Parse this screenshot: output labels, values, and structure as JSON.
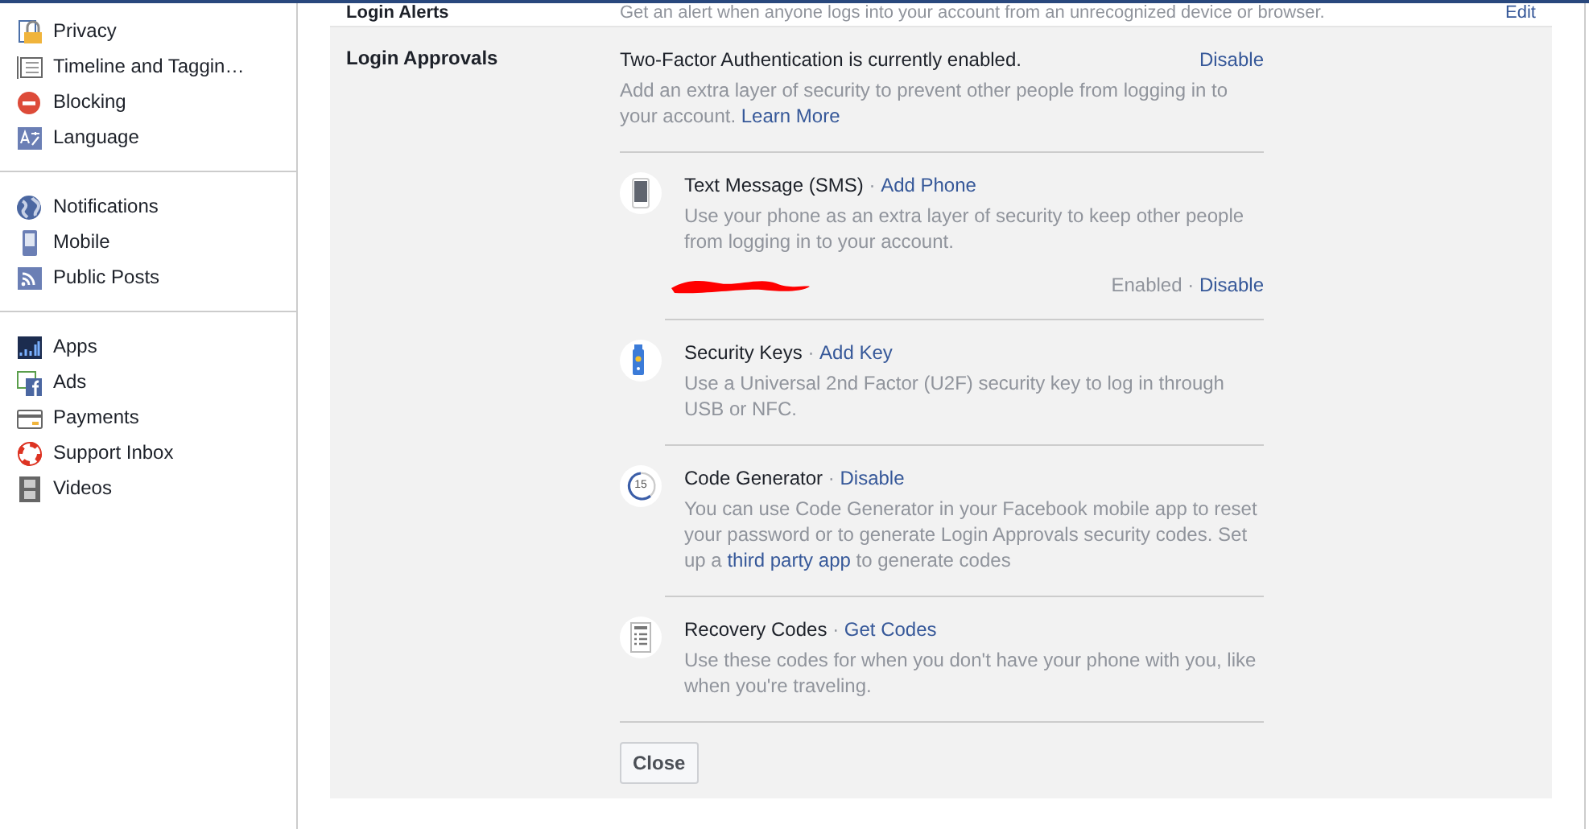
{
  "sidebar": {
    "groups": [
      {
        "items": [
          {
            "label": "Privacy"
          },
          {
            "label": "Timeline and Taggin…"
          },
          {
            "label": "Blocking"
          },
          {
            "label": "Language"
          }
        ]
      },
      {
        "items": [
          {
            "label": "Notifications"
          },
          {
            "label": "Mobile"
          },
          {
            "label": "Public Posts"
          }
        ]
      },
      {
        "items": [
          {
            "label": "Apps"
          },
          {
            "label": "Ads"
          },
          {
            "label": "Payments"
          },
          {
            "label": "Support Inbox"
          },
          {
            "label": "Videos"
          }
        ]
      }
    ]
  },
  "login_alerts": {
    "title": "Login Alerts",
    "description": "Get an alert when anyone logs into your account from an unrecognized device or browser.",
    "action": "Edit"
  },
  "login_approvals": {
    "title": "Login Approvals",
    "status": "Two-Factor Authentication is currently enabled.",
    "action": "Disable",
    "description": [
      {
        "kind": "text",
        "text": "Add an extra layer of security to prevent other people from logging in to your account. "
      },
      {
        "kind": "link",
        "text": "Learn More"
      }
    ],
    "methods": [
      {
        "title": "Text Message (SMS)",
        "separator": "·",
        "action": "Add Phone",
        "state_separator": "·",
        "description": [
          {
            "kind": "text",
            "text": "Use your phone as an extra layer of security to keep other people from logging in to your account."
          }
        ],
        "state": "Enabled",
        "state_action": "Disable"
      },
      {
        "title": "Security Keys",
        "separator": "·",
        "action": "Add Key",
        "description": [
          {
            "kind": "text",
            "text": "Use a Universal 2nd Factor (U2F) security key to log in through USB or NFC."
          }
        ]
      },
      {
        "title": "Code Generator",
        "separator": "·",
        "badge": "15",
        "action": "Disable",
        "description": [
          {
            "kind": "text",
            "text": "You can use Code Generator in your Facebook mobile app to reset your password or to generate Login Approvals security codes. Set up a "
          },
          {
            "kind": "link",
            "text": "third party app"
          },
          {
            "kind": "text",
            "text": " to generate codes"
          }
        ]
      },
      {
        "title": "Recovery Codes",
        "separator": "·",
        "action": "Get Codes",
        "description": [
          {
            "kind": "text",
            "text": "Use these codes for when you don't have your phone with you, like when you're traveling."
          }
        ]
      }
    ],
    "close_button": "Close"
  }
}
